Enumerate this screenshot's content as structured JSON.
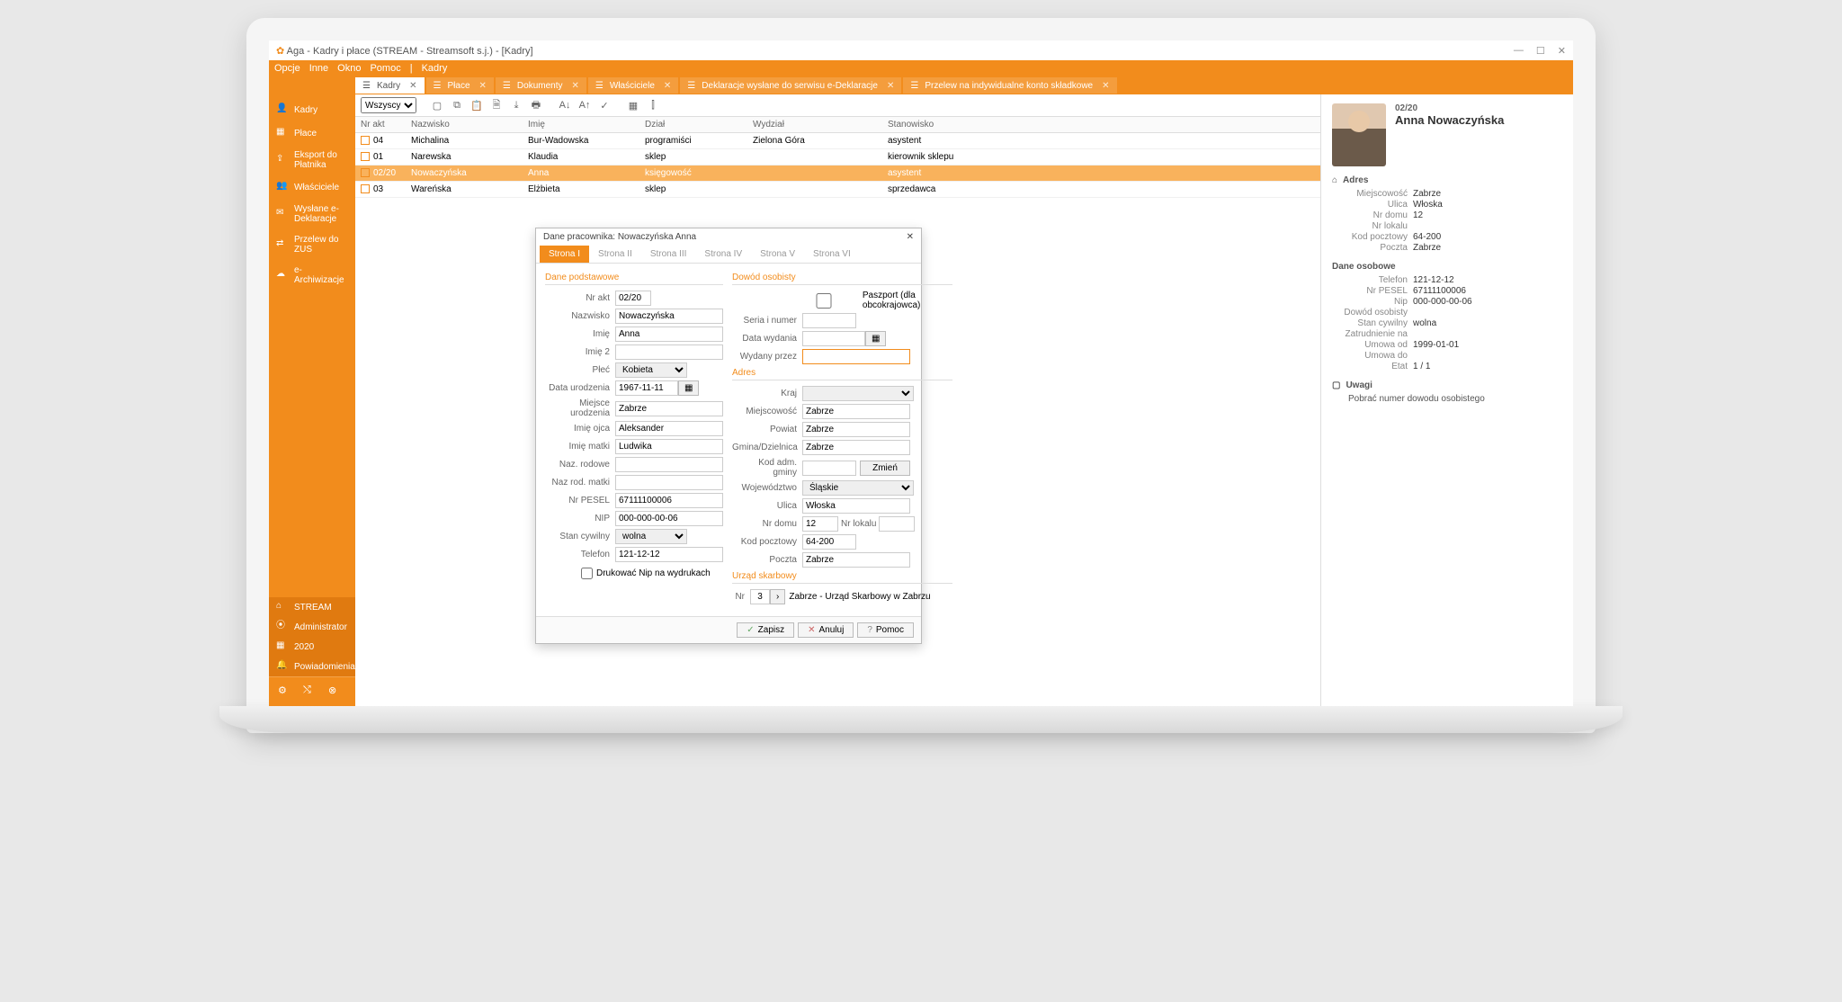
{
  "window": {
    "title": "Aga - Kadry i płace (STREAM - Streamsoft s.j.) - [Kadry]"
  },
  "menu": [
    "Opcje",
    "Inne",
    "Okno",
    "Pomoc",
    "Kadry"
  ],
  "tabs": [
    {
      "label": "Kadry",
      "active": true
    },
    {
      "label": "Płace"
    },
    {
      "label": "Dokumenty"
    },
    {
      "label": "Właściciele"
    },
    {
      "label": "Deklaracje wysłane do serwisu e-Deklaracje"
    },
    {
      "label": "Przelew na indywidualne konto składkowe"
    }
  ],
  "sidebar": {
    "items": [
      {
        "icon": "person-icon",
        "label": "Kadry"
      },
      {
        "icon": "money-icon",
        "label": "Płace"
      },
      {
        "icon": "export-icon",
        "label": "Eksport do Płatnika"
      },
      {
        "icon": "owners-icon",
        "label": "Właściciele"
      },
      {
        "icon": "sent-icon",
        "label": "Wysłane e-Deklaracje"
      },
      {
        "icon": "transfer-icon",
        "label": "Przelew do ZUS"
      },
      {
        "icon": "archive-icon",
        "label": "e-Archiwizacje"
      }
    ],
    "bottom": [
      {
        "icon": "home-icon",
        "label": "STREAM"
      },
      {
        "icon": "admin-icon",
        "label": "Administrator"
      },
      {
        "icon": "calendar-icon",
        "label": "2020"
      },
      {
        "icon": "bell-icon",
        "label": "Powiadomienia"
      }
    ]
  },
  "toolbar": {
    "filter": "Wszyscy"
  },
  "grid": {
    "columns": [
      "Nr akt",
      "Nazwisko",
      "Imię",
      "Dział",
      "Wydział",
      "Stanowisko"
    ],
    "rows": [
      {
        "nr": "04",
        "nazwisko": "Michalina",
        "imie": "Bur-Wadowska",
        "dzial": "programiści",
        "wydzial": "Zielona Góra",
        "stan": "asystent"
      },
      {
        "nr": "01",
        "nazwisko": "Narewska",
        "imie": "Klaudia",
        "dzial": "sklep",
        "wydzial": "",
        "stan": "kierownik sklepu"
      },
      {
        "nr": "02/20",
        "nazwisko": "Nowaczyńska",
        "imie": "Anna",
        "dzial": "księgowość",
        "wydzial": "",
        "stan": "asystent",
        "selected": true
      },
      {
        "nr": "03",
        "nazwisko": "Wareńska",
        "imie": "Elżbieta",
        "dzial": "sklep",
        "wydzial": "",
        "stan": "sprzedawca"
      }
    ]
  },
  "detail": {
    "id": "02/20",
    "name": "Anna Nowaczyńska",
    "adres": {
      "title": "Adres",
      "rows": [
        {
          "l": "Miejscowość",
          "v": "Zabrze"
        },
        {
          "l": "Ulica",
          "v": "Włoska"
        },
        {
          "l": "Nr domu",
          "v": "12"
        },
        {
          "l": "Nr lokalu",
          "v": ""
        },
        {
          "l": "Kod pocztowy",
          "v": "64-200"
        },
        {
          "l": "Poczta",
          "v": "Zabrze"
        }
      ]
    },
    "osobowe": {
      "title": "Dane osobowe",
      "rows": [
        {
          "l": "Telefon",
          "v": "121-12-12"
        },
        {
          "l": "Nr PESEL",
          "v": "67111100006"
        },
        {
          "l": "Nip",
          "v": "000-000-00-06"
        },
        {
          "l": "Dowód osobisty",
          "v": ""
        },
        {
          "l": "Stan cywilny",
          "v": "wolna"
        },
        {
          "l": "Zatrudnienie na",
          "v": ""
        },
        {
          "l": "Umowa od",
          "v": "1999-01-01"
        },
        {
          "l": "Umowa do",
          "v": ""
        },
        {
          "l": "Etat",
          "v": "1 / 1"
        }
      ]
    },
    "uwagi": {
      "title": "Uwagi",
      "text": "Pobrać numer dowodu osobistego"
    }
  },
  "dialog": {
    "title": "Dane pracownika: Nowaczyńska Anna",
    "tabs": [
      "Strona I",
      "Strona II",
      "Strona III",
      "Strona IV",
      "Strona V",
      "Strona VI"
    ],
    "section_podstawowe": "Dane podstawowe",
    "section_dowod": "Dowód osobisty",
    "section_adres": "Adres",
    "section_urzad": "Urząd skarbowy",
    "labels": {
      "nr_akt": "Nr akt",
      "nazwisko": "Nazwisko",
      "imie": "Imię",
      "imie2": "Imię 2",
      "plec": "Płeć",
      "data_ur": "Data urodzenia",
      "miejsce_ur": "Miejsce urodzenia",
      "imie_ojca": "Imię ojca",
      "imie_matki": "Imię matki",
      "naz_rod": "Naz. rodowe",
      "naz_matki": "Naz rod. matki",
      "pesel": "Nr PESEL",
      "nip": "NIP",
      "stan_cyw": "Stan cywilny",
      "telefon": "Telefon",
      "drukowac": "Drukować Nip na wydrukach",
      "paszport": "Paszport (dla obcokrajowca)",
      "seria": "Seria i numer",
      "data_wyd": "Data wydania",
      "wydany": "Wydany przez",
      "kraj": "Kraj",
      "miejscowosc": "Miejscowość",
      "powiat": "Powiat",
      "gmina": "Gmina/Dzielnica",
      "kod_adm": "Kod adm. gminy",
      "zmien": "Zmień",
      "woj": "Województwo",
      "ulica": "Ulica",
      "nr_domu": "Nr domu",
      "nr_lokalu": "Nr lokalu",
      "kod_poczt": "Kod pocztowy",
      "poczta": "Poczta",
      "nr": "Nr",
      "urzad_text": "Zabrze - Urząd Skarbowy w Zabrzu"
    },
    "values": {
      "nr_akt": "02/20",
      "nazwisko": "Nowaczyńska",
      "imie": "Anna",
      "imie2": "",
      "plec": "Kobieta",
      "data_ur": "1967-11-11",
      "miejsce_ur": "Zabrze",
      "imie_ojca": "Aleksander",
      "imie_matki": "Ludwika",
      "naz_rod": "",
      "naz_matki": "",
      "pesel": "67111100006",
      "nip": "000-000-00-06",
      "stan_cyw": "wolna",
      "telefon": "121-12-12",
      "seria": "",
      "data_wyd": "",
      "wydany": "",
      "kraj": "",
      "miejscowosc": "Zabrze",
      "powiat": "Zabrze",
      "gmina": "Zabrze",
      "kod_adm": "",
      "woj": "Śląskie",
      "ulica": "Włoska",
      "nr_domu": "12",
      "nr_lokalu": "",
      "kod_poczt": "64-200",
      "poczta": "Zabrze",
      "urzad_nr": "3"
    },
    "buttons": {
      "zapisz": "Zapisz",
      "anuluj": "Anuluj",
      "pomoc": "Pomoc"
    }
  }
}
